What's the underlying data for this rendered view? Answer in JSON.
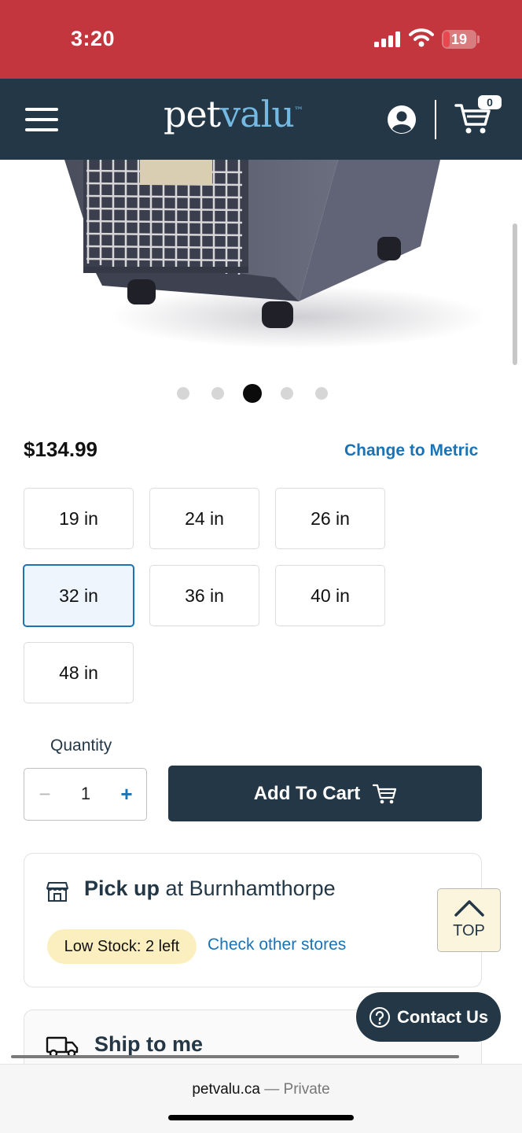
{
  "status_bar": {
    "time": "3:20",
    "battery": "19",
    "battery_level": 0.19
  },
  "header": {
    "logo_pet": "pet",
    "logo_valu": "valu",
    "logo_mark": "™",
    "cart_count": "0"
  },
  "carousel": {
    "dot_count": 5,
    "active_index": 2
  },
  "product": {
    "price": "$134.99",
    "change_units_label": "Change to Metric",
    "sizes": [
      "19 in",
      "24 in",
      "26 in",
      "32 in",
      "36 in",
      "40 in",
      "48 in"
    ],
    "selected_size": "32 in"
  },
  "quantity": {
    "label": "Quantity",
    "minus": "−",
    "value": "1",
    "plus": "+"
  },
  "add_to_cart_label": "Add To Cart",
  "pickup": {
    "label": "Pick up",
    "store_prefix": " at ",
    "store": "Burnhamthorpe",
    "stock_badge": "Low Stock: 2 left",
    "check_other_stores": "Check other stores"
  },
  "top_button_label": "TOP",
  "ship": {
    "label": "Ship to me"
  },
  "contact_label": "Contact Us",
  "browser": {
    "domain": "petvalu.ca",
    "separator": " — ",
    "mode": "Private"
  },
  "colors": {
    "status_bar": "#c3363d",
    "header": "#233746",
    "link": "#1a73b5",
    "stock_badge": "#fcefbf",
    "logo_accent": "#74b9e3"
  },
  "icons": [
    "signal-icon",
    "wifi-icon",
    "menu-icon",
    "account-icon",
    "cart-icon",
    "store-icon",
    "truck-icon",
    "chevron-up-icon",
    "help-circle-icon"
  ]
}
